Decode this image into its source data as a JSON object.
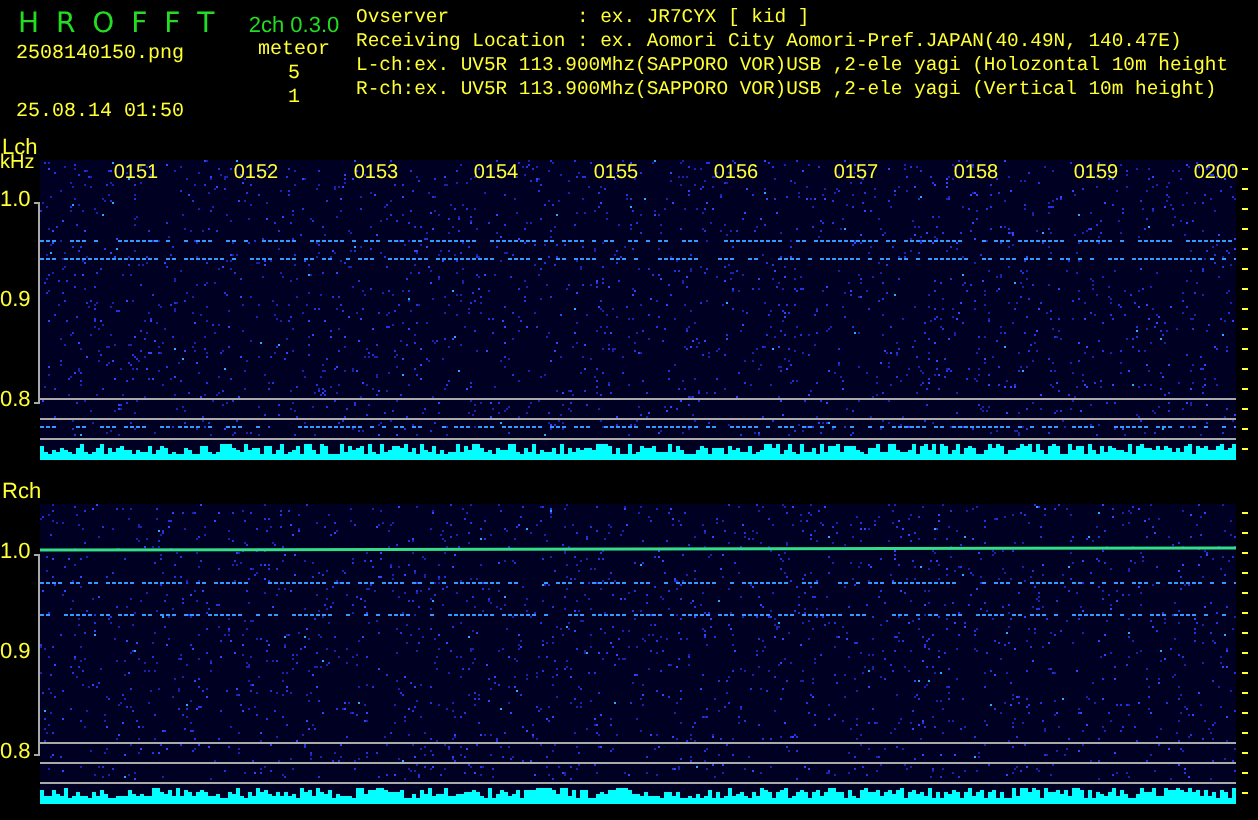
{
  "header": {
    "app_title": "H R O F F T",
    "version": "2ch 0.3.0",
    "filename": "2508140150.png",
    "datetime": "25.08.14 01:50",
    "meteor_label": "meteor",
    "meteor_counts": [
      "5",
      "1"
    ],
    "info_lines": [
      "Ovserver           : ex. JR7CYX [ kid ]",
      "Receiving Location : ex. Aomori City Aomori-Pref.JAPAN(40.49N, 140.47E)",
      "L-ch:ex. UV5R 113.900Mhz(SAPPORO VOR)USB ,2-ele yagi (Holozontal 10m height",
      "R-ch:ex. UV5R 113.900Mhz(SAPPORO VOR)USB ,2-ele yagi (Vertical 10m height)"
    ]
  },
  "channels": [
    {
      "label": "Lch",
      "unit": "kHz",
      "time_labels": [
        "0151",
        "0152",
        "0153",
        "0154",
        "0155",
        "0156",
        "0157",
        "0158",
        "0159",
        "0200"
      ],
      "axis_labels": [
        "1.0",
        "0.9",
        "0.8"
      ]
    },
    {
      "label": "Rch",
      "axis_labels": [
        "1.0",
        "0.9",
        "0.8"
      ]
    }
  ]
}
